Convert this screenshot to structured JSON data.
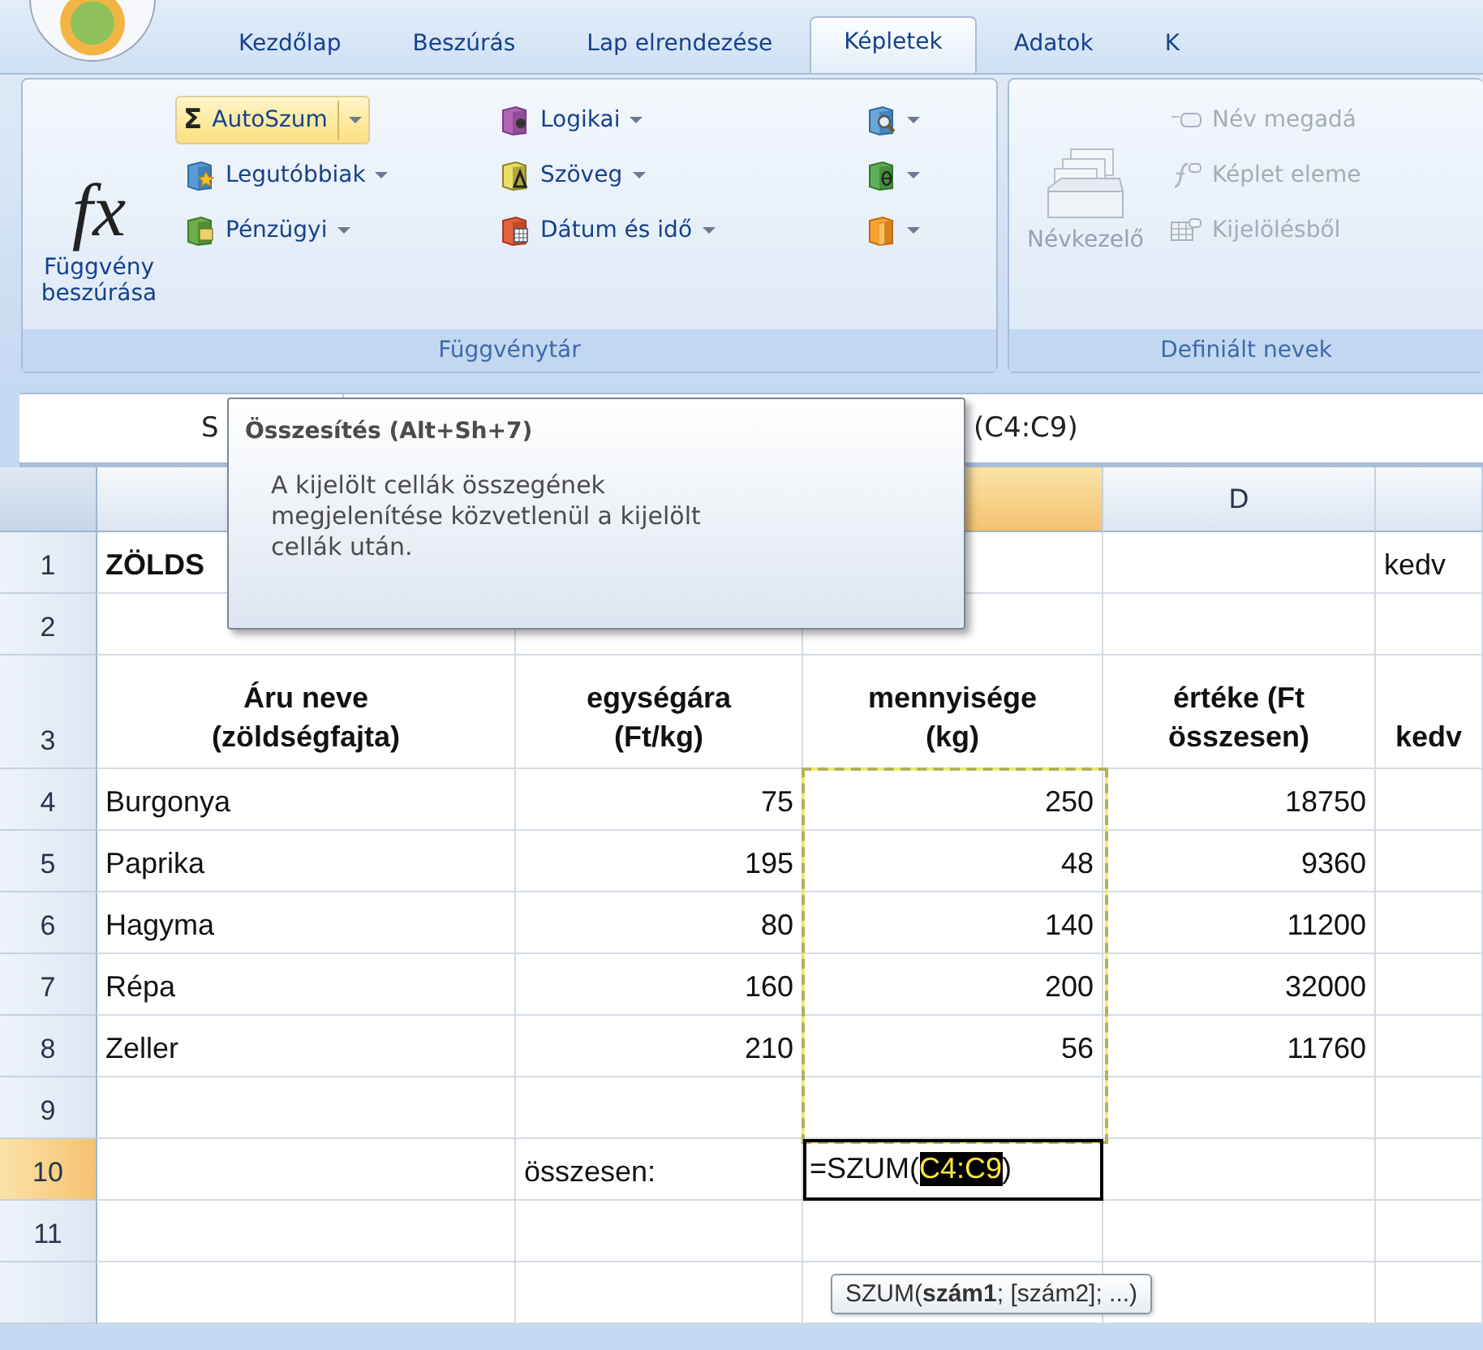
{
  "tabs": [
    {
      "label": "Kezdőlap",
      "selected": false
    },
    {
      "label": "Beszúrás",
      "selected": false
    },
    {
      "label": "Lap elrendezése",
      "selected": false
    },
    {
      "label": "Képletek",
      "selected": true
    },
    {
      "label": "Adatok",
      "selected": false
    },
    {
      "label": "K",
      "selected": false
    }
  ],
  "ribbon": {
    "groups": [
      {
        "label": "Függvénytár",
        "large": {
          "glyph": "fx",
          "label": "Függvény\nbeszúrása",
          "disabled": false
        },
        "columns": [
          [
            {
              "glyph": "Σ",
              "label": "AutoSzum",
              "dropdown": true,
              "highlighted": true,
              "disabled": false
            },
            {
              "label": "Legutóbbiak",
              "dropdown": true,
              "highlighted": false,
              "disabled": false
            },
            {
              "label": "Pénzügyi",
              "dropdown": true,
              "highlighted": false,
              "disabled": false
            }
          ],
          [
            {
              "label": "Logikai",
              "dropdown": true,
              "highlighted": false,
              "disabled": false
            },
            {
              "label": "Szöveg",
              "dropdown": true,
              "highlighted": false,
              "disabled": false
            },
            {
              "label": "Dátum és idő",
              "dropdown": true,
              "highlighted": false,
              "disabled": false
            }
          ],
          [
            {
              "dropdown": true,
              "highlighted": false,
              "disabled": false
            },
            {
              "dropdown": true,
              "highlighted": false,
              "disabled": false
            },
            {
              "dropdown": true,
              "highlighted": false,
              "disabled": false
            }
          ]
        ]
      },
      {
        "label": "Definiált nevek",
        "large": {
          "label": "Névkezelő",
          "disabled": true
        },
        "columns": [
          [
            {
              "label": "Név megadá",
              "dropdown": false,
              "highlighted": false,
              "disabled": true
            },
            {
              "label": "Képlet eleme",
              "dropdown": false,
              "highlighted": false,
              "disabled": true
            },
            {
              "label": "Kijelölésből",
              "dropdown": false,
              "highlighted": false,
              "disabled": true
            }
          ]
        ]
      }
    ]
  },
  "formula_bar": {
    "name_box": "S",
    "formula": "(C4:C9)"
  },
  "tooltip": {
    "title": "Összesítés (Alt+Sh+7)",
    "body": "A kijelölt cellák összegének megjelenítése közvetlenül a kijelölt cellák után."
  },
  "sheet": {
    "columns": [
      {
        "selected": false
      },
      null,
      {
        "selected": true
      },
      {
        "label": "D",
        "selected": false
      },
      {
        "selected": false
      }
    ],
    "rows": [
      {
        "number": "1",
        "selected": false,
        "cells": [
          {
            "kind": "title",
            "text": "ZÖLDS"
          },
          null,
          null,
          null,
          {
            "kind": "text",
            "text": "kedv"
          }
        ]
      },
      {
        "number": "2",
        "selected": false,
        "cells": [
          null,
          null,
          null,
          null,
          null
        ]
      },
      {
        "number": "3",
        "selected": false,
        "cells": [
          {
            "kind": "header",
            "text": "Áru neve\n(zöldségfajta)"
          },
          {
            "kind": "header",
            "text": "egységára\n(Ft/kg)"
          },
          {
            "kind": "header",
            "text": "mennyisége\n(kg)"
          },
          {
            "kind": "header",
            "text": "értéke (Ft\nösszesen)"
          },
          {
            "kind": "header",
            "text": "kedv"
          }
        ]
      },
      {
        "number": "4",
        "selected": false,
        "cells": [
          {
            "kind": "text",
            "text": "Burgonya"
          },
          {
            "kind": "number",
            "text": "75"
          },
          {
            "kind": "number",
            "text": "250",
            "in_range": true
          },
          {
            "kind": "number",
            "text": "18750"
          },
          null
        ]
      },
      {
        "number": "5",
        "selected": false,
        "cells": [
          {
            "kind": "text",
            "text": "Paprika"
          },
          {
            "kind": "number",
            "text": "195"
          },
          {
            "kind": "number",
            "text": "48",
            "in_range": true
          },
          {
            "kind": "number",
            "text": "9360"
          },
          null
        ]
      },
      {
        "number": "6",
        "selected": false,
        "cells": [
          {
            "kind": "text",
            "text": "Hagyma"
          },
          {
            "kind": "number",
            "text": "80"
          },
          {
            "kind": "number",
            "text": "140",
            "in_range": true
          },
          {
            "kind": "number",
            "text": "11200"
          },
          null
        ]
      },
      {
        "number": "7",
        "selected": false,
        "cells": [
          {
            "kind": "text",
            "text": "Répa"
          },
          {
            "kind": "number",
            "text": "160"
          },
          {
            "kind": "number",
            "text": "200",
            "in_range": true
          },
          {
            "kind": "number",
            "text": "32000"
          },
          null
        ]
      },
      {
        "number": "8",
        "selected": false,
        "cells": [
          {
            "kind": "text",
            "text": "Zeller"
          },
          {
            "kind": "number",
            "text": "210"
          },
          {
            "kind": "number",
            "text": "56",
            "in_range": true
          },
          {
            "kind": "number",
            "text": "11760"
          },
          null
        ]
      },
      {
        "number": "9",
        "selected": false,
        "cells": [
          null,
          null,
          {
            "kind": "empty",
            "in_range": true
          },
          null,
          null
        ]
      },
      {
        "number": "10",
        "selected": true,
        "cells": [
          null,
          {
            "kind": "text",
            "text": "összesen:"
          },
          {
            "kind": "formula",
            "before": "=SZUM(",
            "ref": "C4:C9",
            "after": ")",
            "active": true
          },
          null,
          null
        ]
      },
      {
        "number": "11",
        "selected": false,
        "cells": [
          null,
          null,
          null,
          null,
          null
        ]
      },
      {
        "selected": false,
        "cells": [
          null,
          null,
          null,
          null,
          null
        ]
      }
    ]
  },
  "function_hint": "SZUM(**szám1**; [szám2]; ...)"
}
